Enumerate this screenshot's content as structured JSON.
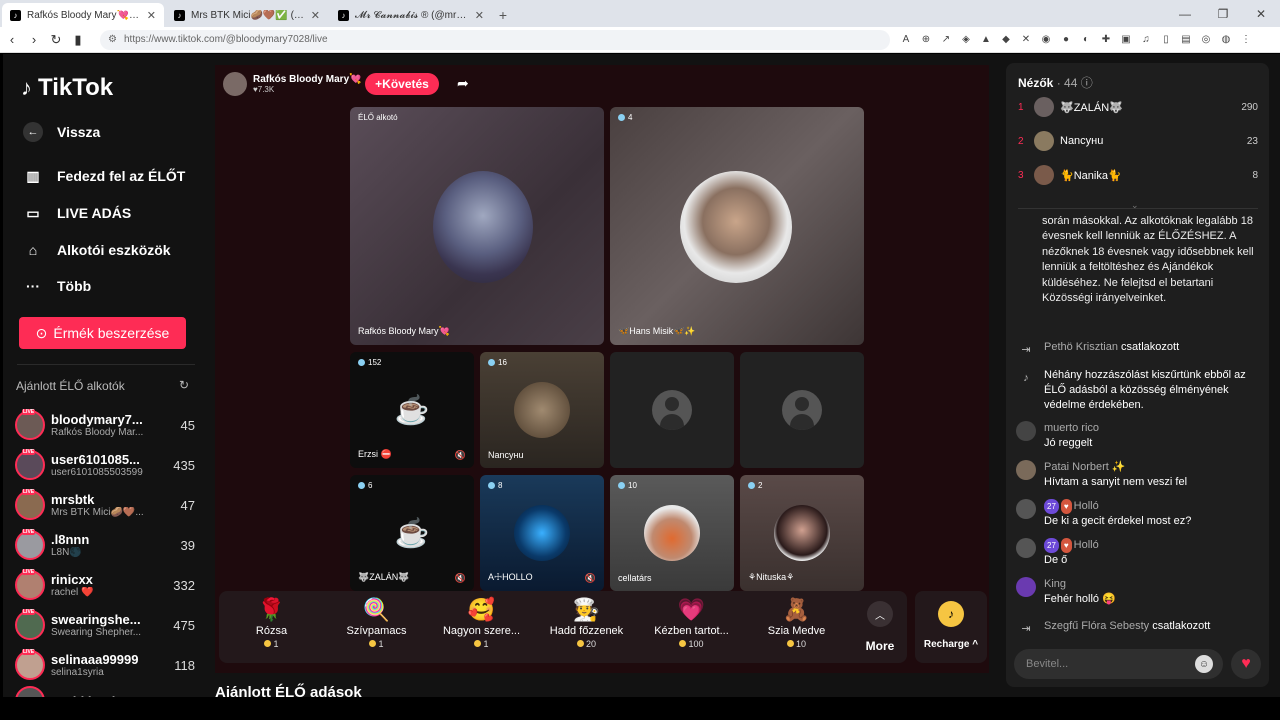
{
  "browser": {
    "tabs": [
      {
        "label": "Rafkós Bloody Mary💘 (@bl",
        "active": true
      },
      {
        "label": "Mrs BTK Mici🥔🤎✅ (@mrsbtk)",
        "active": false
      },
      {
        "label": "𝓜𝓻 𝓒𝓪𝓷𝓷𝓪𝓫𝓲𝓼 ® (@mrcannabis_)",
        "active": false
      }
    ],
    "new_tab": "+",
    "url": "https://www.tiktok.com/@bloodymary7028/live"
  },
  "sidebar": {
    "logo": "TikTok",
    "back": "Vissza",
    "nav": [
      "Fedezd fel az ÉLŐT",
      "LIVE ADÁS",
      "Alkotói eszközök",
      "Több"
    ],
    "coins_button": "Érmék beszerzése",
    "recommended_title": "Ajánlott ÉLŐ alkotók",
    "live_tag": "LIVE",
    "creators": [
      {
        "name": "bloodymary7...",
        "sub": "Rafkós Bloody Mar...",
        "count": "45",
        "color": "#6c5a55"
      },
      {
        "name": "user6101085...",
        "sub": "user6101085503599",
        "count": "435",
        "color": "#5a4a5a"
      },
      {
        "name": "mrsbtk",
        "sub": "Mrs BTK Mici🥔🤎...",
        "count": "47",
        "color": "#8a6a50"
      },
      {
        "name": ".l8nnn",
        "sub": "L8N🌑",
        "count": "39",
        "color": "#9a9aa0"
      },
      {
        "name": "rinicxx",
        "sub": "rachel ❤️",
        "count": "332",
        "color": "#b08070"
      },
      {
        "name": "swearingshe...",
        "sub": "Swearing Shepher...",
        "count": "475",
        "color": "#506a50"
      },
      {
        "name": "selinaaa99999",
        "sub": "selina1syria",
        "count": "118",
        "color": "#c0a090"
      },
      {
        "name": "yeahkingdom",
        "sub": "",
        "count": "",
        "color": "#555"
      }
    ],
    "bottom_title": "Ajánlott ÉLŐ adások"
  },
  "stream": {
    "host_name": "Rafkós Bloody Mary💘",
    "host_likes": "♥7.3K",
    "follow": "+Követés",
    "main_tile": {
      "label": "ÉLŐ alkotó",
      "name": "Rafkós Bloody Mary💘"
    },
    "guest_tile": {
      "badge": "4",
      "name": "🦋Hans Misik🦋✨"
    },
    "small_tiles": [
      {
        "badge": "152",
        "name": "Erzsi ⛔"
      },
      {
        "badge": "16",
        "name": "Nancyнu"
      },
      {
        "badge": "",
        "name": ""
      },
      {
        "badge": "",
        "name": ""
      },
      {
        "badge": "6",
        "name": "🐺ZALÁN🐺"
      },
      {
        "badge": "8",
        "name": "A☩HOLLO"
      },
      {
        "badge": "10",
        "name": "cellatárs"
      },
      {
        "badge": "2",
        "name": "⚘Nituska⚘"
      }
    ]
  },
  "gifts": [
    {
      "name": "Rózsa",
      "price": "1",
      "icon": "🌹"
    },
    {
      "name": "Szívpamacs",
      "price": "1",
      "icon": "🍭"
    },
    {
      "name": "Nagyon szere...",
      "price": "1",
      "icon": "🥰"
    },
    {
      "name": "Hadd főzzenek",
      "price": "20",
      "icon": "🧑‍🍳"
    },
    {
      "name": "Kézben tartot...",
      "price": "100",
      "icon": "💗"
    },
    {
      "name": "Szia Medve",
      "price": "10",
      "icon": "🧸"
    }
  ],
  "more": "More",
  "recharge": "Recharge ^",
  "chat": {
    "viewers_label": "Nézők",
    "viewers_count": "· 44",
    "top_viewers": [
      {
        "rank": "1",
        "name": "🐺ZALÁN🐺",
        "score": "290"
      },
      {
        "rank": "2",
        "name": "Nancyнu",
        "score": "23"
      },
      {
        "rank": "3",
        "name": "🐈Nanika🐈",
        "score": "8"
      }
    ],
    "rules": "során másokkal. Az alkotóknak legalább 18 évesnek kell lenniük az ÉLŐZÉSHEZ. A nézőknek 18 évesnek vagy idősebbnek kell lenniük a feltöltéshez és Ajándékok küldéséhez. Ne felejtsd el betartani Közösségi irányelveinket.",
    "join1_user": "Pethö Krisztian",
    "join1_text": "csatlakozott",
    "notice": "Néhány hozzászólást kiszűrtünk ebből az ÉLŐ adásból a közösség élményének védelme érdekében.",
    "messages": [
      {
        "user": "muerto rico",
        "text": "Jó reggelt",
        "lvl": "",
        "fan": ""
      },
      {
        "user": "Patai Norbert ✨",
        "text": "Hívtam a sanyit nem veszi fel",
        "lvl": "",
        "fan": ""
      },
      {
        "user": "Holló",
        "text": "De ki a gecit érdekel most ez?",
        "lvl": "27",
        "fan": "♥"
      },
      {
        "user": "Holló",
        "text": "De ő",
        "lvl": "27",
        "fan": "♥"
      },
      {
        "user": "King",
        "text": "Fehér holló 😝",
        "lvl": "",
        "fan": ""
      }
    ],
    "join2_user": "Szegfű Flóra Sebesty",
    "join2_text": "csatlakozott",
    "input_placeholder": "Bevitel..."
  }
}
